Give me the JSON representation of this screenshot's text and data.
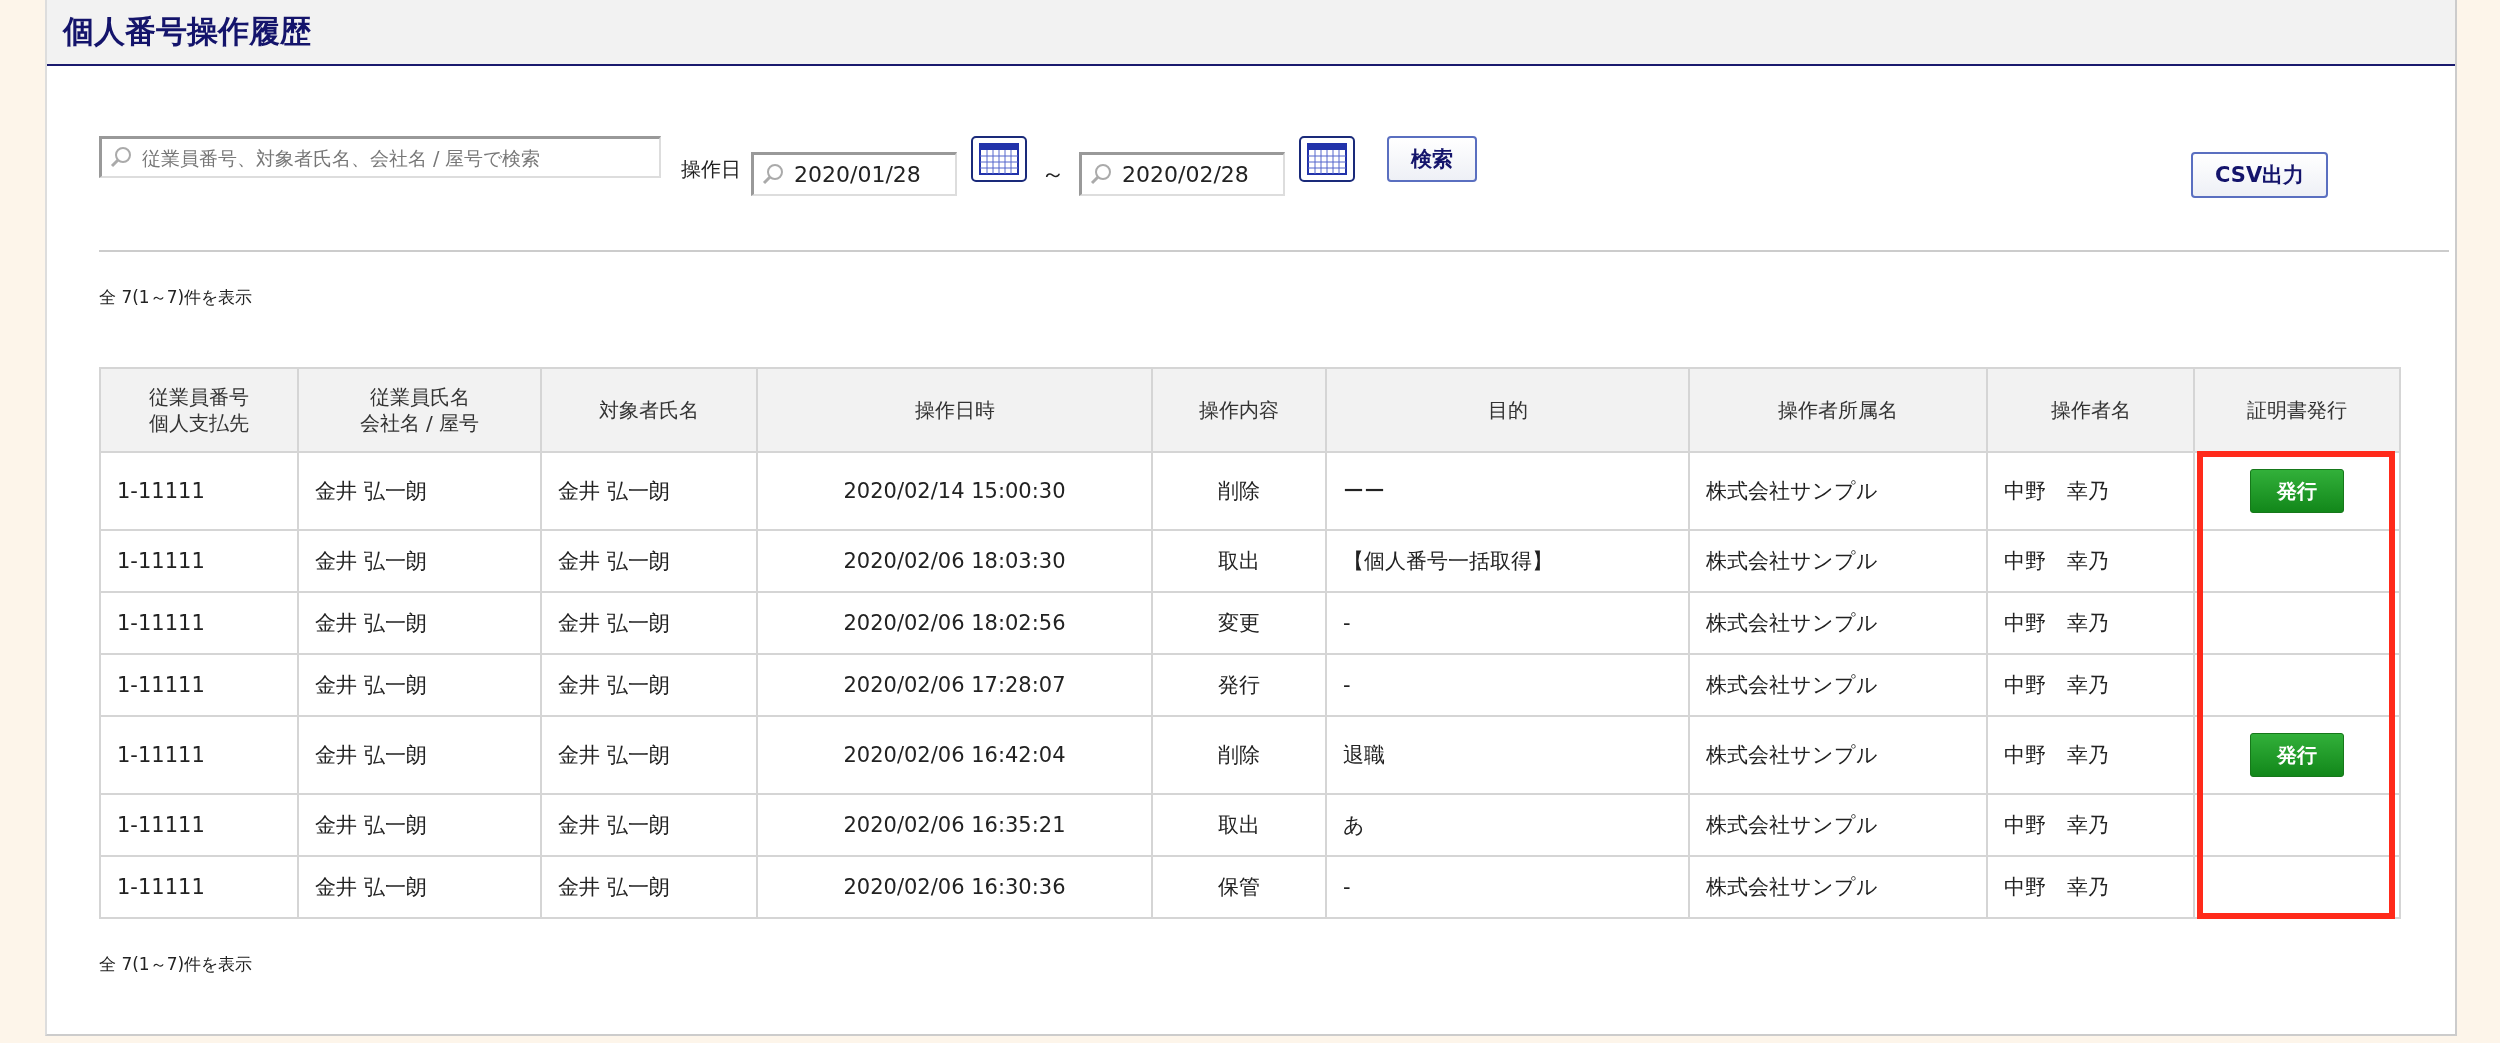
{
  "page": {
    "title": "個人番号操作履歴"
  },
  "filters": {
    "search": {
      "placeholder": "従業員番号、対象者氏名、会社名 / 屋号で検索"
    },
    "date_label": "操作日",
    "date_from": "2020/01/28",
    "range_separator": "～",
    "date_to": "2020/02/28",
    "search_button": "検索",
    "csv_button": "CSV出力"
  },
  "count_top": "全 7(1～7)件を表示",
  "table": {
    "columns": [
      {
        "lines": [
          "従業員番号",
          "個人支払先"
        ],
        "highlighted": false
      },
      {
        "lines": [
          "従業員氏名",
          "会社名 / 屋号"
        ],
        "highlighted": false
      },
      {
        "lines": [
          "対象者氏名"
        ],
        "highlighted": false
      },
      {
        "lines": [
          "操作日時"
        ],
        "highlighted": false
      },
      {
        "lines": [
          "操作内容"
        ],
        "highlighted": false
      },
      {
        "lines": [
          "目的"
        ],
        "highlighted": false
      },
      {
        "lines": [
          "操作者所属名"
        ],
        "highlighted": false
      },
      {
        "lines": [
          "操作者名"
        ],
        "highlighted": false
      },
      {
        "lines": [
          "証明書発行"
        ],
        "highlighted": true
      }
    ],
    "rows": [
      {
        "cells": [
          "1-11111",
          "金井 弘一朗",
          "金井 弘一朗",
          "2020/02/14 15:00:30",
          "削除",
          "ーー",
          "株式会社サンプル",
          "中野　幸乃"
        ],
        "issue_button": "発行"
      },
      {
        "cells": [
          "1-11111",
          "金井 弘一朗",
          "金井 弘一朗",
          "2020/02/06 18:03:30",
          "取出",
          "【個人番号一括取得】",
          "株式会社サンプル",
          "中野　幸乃"
        ]
      },
      {
        "cells": [
          "1-11111",
          "金井 弘一朗",
          "金井 弘一朗",
          "2020/02/06 18:02:56",
          "変更",
          "-",
          "株式会社サンプル",
          "中野　幸乃"
        ]
      },
      {
        "cells": [
          "1-11111",
          "金井 弘一朗",
          "金井 弘一朗",
          "2020/02/06 17:28:07",
          "発行",
          "-",
          "株式会社サンプル",
          "中野　幸乃"
        ]
      },
      {
        "cells": [
          "1-11111",
          "金井 弘一朗",
          "金井 弘一朗",
          "2020/02/06 16:42:04",
          "削除",
          "退職",
          "株式会社サンプル",
          "中野　幸乃"
        ],
        "issue_button": "発行"
      },
      {
        "cells": [
          "1-11111",
          "金井 弘一朗",
          "金井 弘一朗",
          "2020/02/06 16:35:21",
          "取出",
          "あ",
          "株式会社サンプル",
          "中野　幸乃"
        ]
      },
      {
        "cells": [
          "1-11111",
          "金井 弘一朗",
          "金井 弘一朗",
          "2020/02/06 16:30:36",
          "保管",
          "-",
          "株式会社サンプル",
          "中野　幸乃"
        ]
      }
    ]
  },
  "count_bottom": "全 7(1～7)件を表示"
}
